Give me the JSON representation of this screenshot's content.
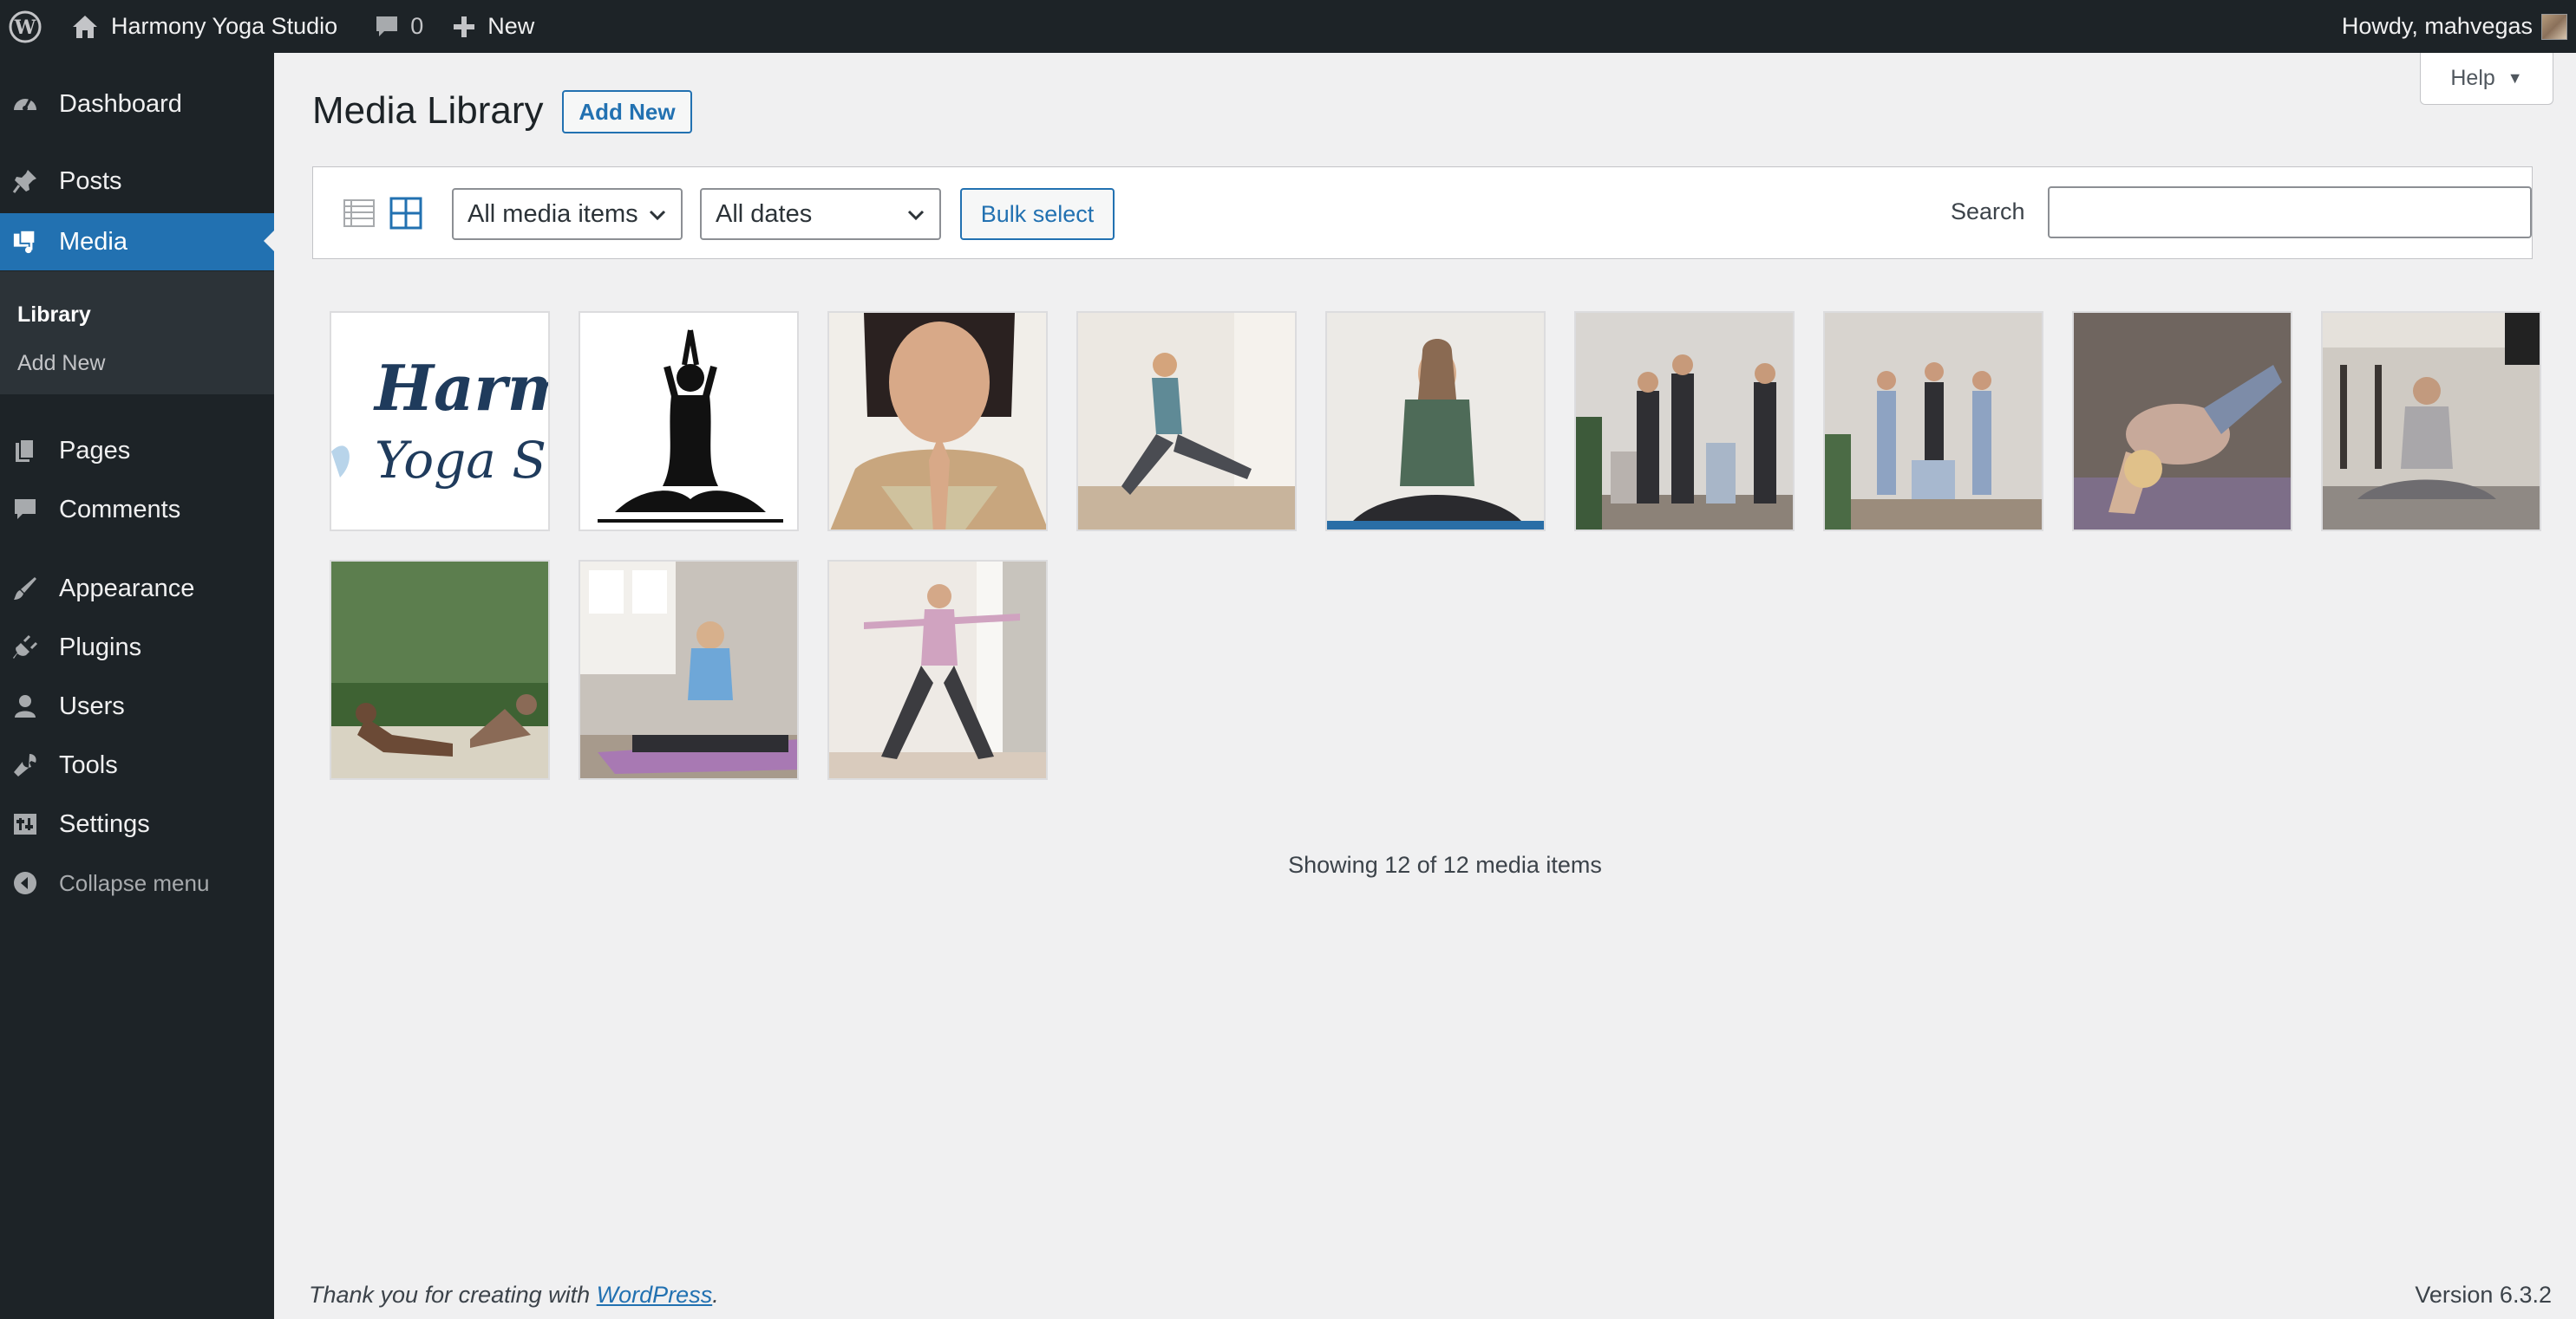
{
  "adminbar": {
    "site_name": "Harmony Yoga Studio",
    "comments_count": "0",
    "new_label": "New",
    "howdy": "Howdy, mahvegas"
  },
  "sidebar": {
    "items": [
      {
        "label": "Dashboard",
        "icon": "dashboard-icon"
      },
      {
        "label": "Posts",
        "icon": "pin-icon"
      },
      {
        "label": "Media",
        "icon": "media-icon"
      },
      {
        "label": "Pages",
        "icon": "pages-icon"
      },
      {
        "label": "Comments",
        "icon": "comment-icon"
      },
      {
        "label": "Appearance",
        "icon": "brush-icon"
      },
      {
        "label": "Plugins",
        "icon": "plug-icon"
      },
      {
        "label": "Users",
        "icon": "user-icon"
      },
      {
        "label": "Tools",
        "icon": "wrench-icon"
      },
      {
        "label": "Settings",
        "icon": "settings-icon"
      }
    ],
    "submenu": {
      "library": "Library",
      "add_new": "Add New"
    },
    "collapse": "Collapse menu"
  },
  "main": {
    "title": "Media Library",
    "add_new": "Add New",
    "help": "Help",
    "filters": {
      "media_type": "All media items",
      "dates": "All dates",
      "bulk_select": "Bulk select",
      "search_label": "Search",
      "search_value": ""
    },
    "thumbnails": [
      {
        "alt": "Harmony Yoga Studio logo"
      },
      {
        "alt": "Yoga silhouette"
      },
      {
        "alt": "Woman meditating closeup"
      },
      {
        "alt": "Woman stretching"
      },
      {
        "alt": "Woman meditating green shirt"
      },
      {
        "alt": "Group of women with mats"
      },
      {
        "alt": "Group tree pose"
      },
      {
        "alt": "Crow pose"
      },
      {
        "alt": "Woman meditating in kitchen"
      },
      {
        "alt": "Outdoor yoga"
      },
      {
        "alt": "Woman on mat in studio"
      },
      {
        "alt": "Warrior pose"
      }
    ],
    "showing": "Showing 12 of 12 media items"
  },
  "footer": {
    "thanks_prefix": "Thank you for creating with ",
    "thanks_link": "WordPress",
    "thanks_suffix": ".",
    "version": "Version 6.3.2"
  }
}
